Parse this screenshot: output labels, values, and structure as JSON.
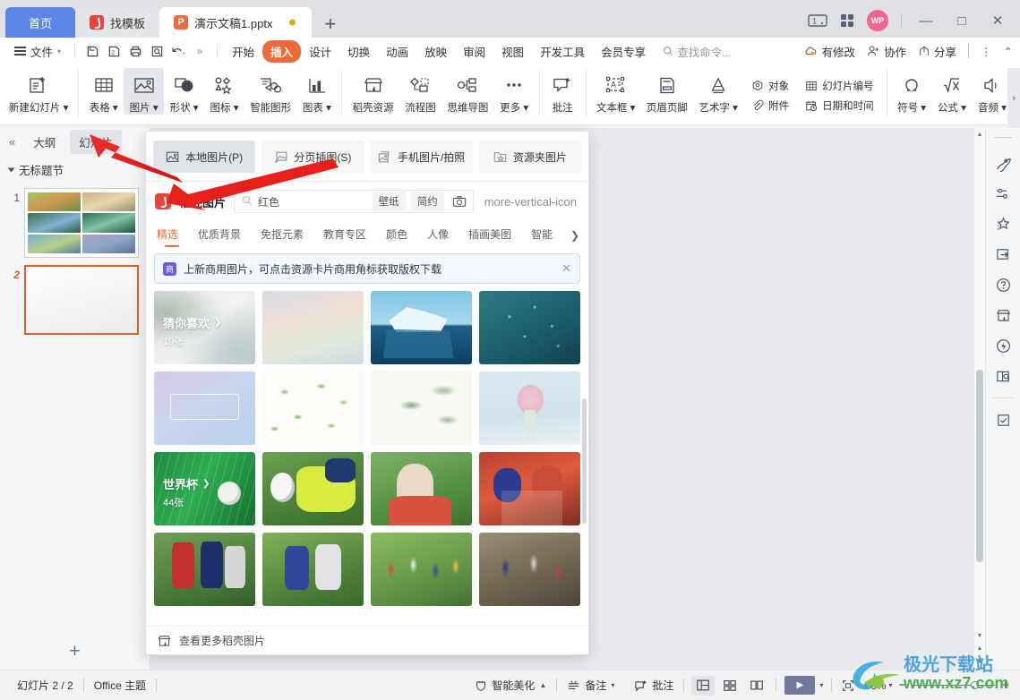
{
  "window": {
    "tabs": [
      {
        "label": "首页",
        "icon": "home-tab",
        "state": "home"
      },
      {
        "label": "找模板",
        "icon": "template-icon",
        "state": "inactive"
      },
      {
        "label": "演示文稿1.pptx",
        "icon": "pptx-icon",
        "state": "active",
        "modified": true
      }
    ],
    "new_tab_label": "+",
    "avatar_label": "WP",
    "controls": {
      "minimize": "—",
      "maximize": "□",
      "close": "✕"
    }
  },
  "menubar": {
    "file_label": "文件",
    "quick_icons": [
      "save-icon",
      "save-as-icon",
      "print-icon",
      "print-preview-icon",
      "undo-icon",
      "more-icon"
    ],
    "items": [
      {
        "label": "开始",
        "selected": false
      },
      {
        "label": "插入",
        "selected": true
      },
      {
        "label": "设计",
        "selected": false
      },
      {
        "label": "切换",
        "selected": false
      },
      {
        "label": "动画",
        "selected": false
      },
      {
        "label": "放映",
        "selected": false
      },
      {
        "label": "审阅",
        "selected": false
      },
      {
        "label": "视图",
        "selected": false
      },
      {
        "label": "开发工具",
        "selected": false
      },
      {
        "label": "会员专享",
        "selected": false
      }
    ],
    "search_placeholder": "查找命令...",
    "right": [
      {
        "label": "有修改",
        "icon": "cloud-modified-icon"
      },
      {
        "label": "协作",
        "icon": "collaborate-icon"
      },
      {
        "label": "分享",
        "icon": "share-icon"
      }
    ],
    "overflow": "⋮",
    "collapse": "⌃"
  },
  "ribbon": {
    "buttons": [
      {
        "label": "新建幻灯片",
        "icon": "new-slide-icon",
        "dropdown": true,
        "active": false
      },
      {
        "label": "表格",
        "icon": "table-icon",
        "dropdown": true,
        "active": false
      },
      {
        "label": "图片",
        "icon": "picture-icon",
        "dropdown": true,
        "active": true
      },
      {
        "label": "形状",
        "icon": "shapes-icon",
        "dropdown": true,
        "active": false
      },
      {
        "label": "图标",
        "icon": "icons-icon",
        "dropdown": true,
        "active": false
      },
      {
        "label": "智能图形",
        "icon": "smartart-icon",
        "dropdown": false,
        "active": false
      },
      {
        "label": "图表",
        "icon": "chart-icon",
        "dropdown": true,
        "active": false
      },
      {
        "label": "稻壳资源",
        "icon": "docer-resource-icon",
        "dropdown": false,
        "active": false
      },
      {
        "label": "流程图",
        "icon": "flowchart-icon",
        "dropdown": false,
        "active": false
      },
      {
        "label": "思维导图",
        "icon": "mindmap-icon",
        "dropdown": false,
        "active": false
      },
      {
        "label": "更多",
        "icon": "more-dots-icon",
        "dropdown": true,
        "active": false
      },
      {
        "label": "批注",
        "icon": "comment-icon",
        "dropdown": false,
        "active": false
      },
      {
        "label": "文本框",
        "icon": "textbox-icon",
        "dropdown": true,
        "active": false
      },
      {
        "label": "页眉页脚",
        "icon": "header-footer-icon",
        "dropdown": false,
        "active": false
      },
      {
        "label": "艺术字",
        "icon": "wordart-icon",
        "dropdown": true,
        "active": false
      },
      {
        "label": "符号",
        "icon": "symbol-icon",
        "dropdown": true,
        "active": false
      },
      {
        "label": "公式",
        "icon": "formula-icon",
        "dropdown": true,
        "active": false
      },
      {
        "label": "音频",
        "icon": "audio-icon",
        "dropdown": true,
        "active": false
      }
    ],
    "stacked": [
      {
        "label": "对象",
        "icon": "object-icon"
      },
      {
        "label": "附件",
        "icon": "attachment-icon"
      },
      {
        "label": "幻灯片编号",
        "icon": "slide-number-icon"
      },
      {
        "label": "日期和时间",
        "icon": "date-time-icon"
      }
    ],
    "expand_chevron": "›"
  },
  "left_pane": {
    "collapse_icon": "«",
    "tabs": [
      {
        "label": "大纲",
        "active": false
      },
      {
        "label": "幻灯片",
        "active": true
      }
    ],
    "section_label": "无标题节",
    "slides": [
      {
        "number": "1",
        "selected": false,
        "type": "images"
      },
      {
        "number": "2",
        "selected": true,
        "type": "blank"
      }
    ],
    "add_slide_label": "+"
  },
  "dropdown": {
    "options": [
      {
        "label": "本地图片(P)",
        "icon": "local-picture-icon",
        "highlighted": true
      },
      {
        "label": "分页插图(S)",
        "icon": "paged-picture-icon",
        "highlighted": false
      },
      {
        "label": "手机图片/拍照",
        "icon": "phone-picture-icon",
        "highlighted": false
      },
      {
        "label": "资源夹图片",
        "icon": "folder-picture-icon",
        "highlighted": false
      }
    ],
    "brand_label": "稻壳图片",
    "search_value": "红色",
    "search_icon": "search-icon",
    "chips": [
      {
        "label": "壁纸"
      },
      {
        "label": "简约"
      }
    ],
    "camera_icon": "camera-icon",
    "kebab_icon": "more-vertical-icon",
    "categories": [
      {
        "label": "精选",
        "active": true
      },
      {
        "label": "优质背景",
        "active": false
      },
      {
        "label": "免抠元素",
        "active": false
      },
      {
        "label": "教育专区",
        "active": false
      },
      {
        "label": "颜色",
        "active": false
      },
      {
        "label": "人像",
        "active": false
      },
      {
        "label": "插画美图",
        "active": false
      },
      {
        "label": "智能",
        "active": false
      }
    ],
    "categories_next": "❯",
    "banner": {
      "text": "上新商用图片，可点击资源卡片商用角标获取版权下载",
      "icon": "商",
      "close": "✕"
    },
    "cells": [
      {
        "id": "c1",
        "caption": "猜你喜欢",
        "count": "19张",
        "arrow": "❯",
        "style": "ink-bamboo"
      },
      {
        "id": "c2",
        "caption": "",
        "count": "",
        "style": "pastel-gradient"
      },
      {
        "id": "c3",
        "caption": "",
        "count": "",
        "style": "iceberg"
      },
      {
        "id": "c4",
        "caption": "",
        "count": "",
        "style": "teal-network"
      },
      {
        "id": "c5",
        "caption": "",
        "count": "",
        "style": "lavender-card"
      },
      {
        "id": "c6",
        "caption": "",
        "count": "",
        "style": "green-leaves"
      },
      {
        "id": "c7",
        "caption": "",
        "count": "",
        "style": "eucalyptus"
      },
      {
        "id": "c8",
        "caption": "",
        "count": "",
        "style": "flower-vase"
      },
      {
        "id": "c9",
        "caption": "世界杯",
        "count": "44张",
        "arrow": "❯",
        "style": "worldcup-green"
      },
      {
        "id": "c10",
        "caption": "",
        "count": "",
        "style": "goalkeeper"
      },
      {
        "id": "c11",
        "caption": "",
        "count": "",
        "style": "kid-soccer"
      },
      {
        "id": "c12",
        "caption": "",
        "count": "",
        "style": "fans-red"
      },
      {
        "id": "c13",
        "caption": "",
        "count": "",
        "style": "players-red"
      },
      {
        "id": "c14",
        "caption": "",
        "count": "",
        "style": "training"
      },
      {
        "id": "c15",
        "caption": "",
        "count": "",
        "style": "kids-field"
      },
      {
        "id": "c16",
        "caption": "",
        "count": "",
        "style": "runners"
      }
    ],
    "footer_label": "查看更多稻壳图片",
    "footer_icon": "docer-icon"
  },
  "right_rail": {
    "icons": [
      {
        "name": "rocket-icon"
      },
      {
        "name": "settings-slider-icon"
      },
      {
        "name": "magic-star-icon"
      },
      {
        "name": "export-frame-icon"
      },
      {
        "name": "help-circle-icon"
      },
      {
        "name": "docer-store-icon"
      },
      {
        "name": "lightning-shield-icon"
      },
      {
        "name": "book-search-icon"
      },
      {
        "name": "checkbox-icon"
      }
    ]
  },
  "statusbar": {
    "slide_count": "幻灯片 2 / 2",
    "theme": "Office 主题",
    "beautify": "智能美化",
    "notes": "备注",
    "comments": "批注",
    "views": [
      {
        "name": "normal-view",
        "active": true
      },
      {
        "name": "slide-sorter-view",
        "active": false
      },
      {
        "name": "reading-view",
        "active": false
      }
    ],
    "play_label": "▶",
    "fit_icon": "fit-slide-icon",
    "zoom": "66%",
    "zoom_out": "−",
    "zoom_in": "+"
  },
  "watermark": {
    "title": "极光下载站",
    "url": "www.xz7.com"
  },
  "colors": {
    "accent_orange": "#ee6a3a",
    "home_blue": "#5d85e6",
    "arrow_red": "#e8201c",
    "selected_slide": "#d9622b"
  }
}
